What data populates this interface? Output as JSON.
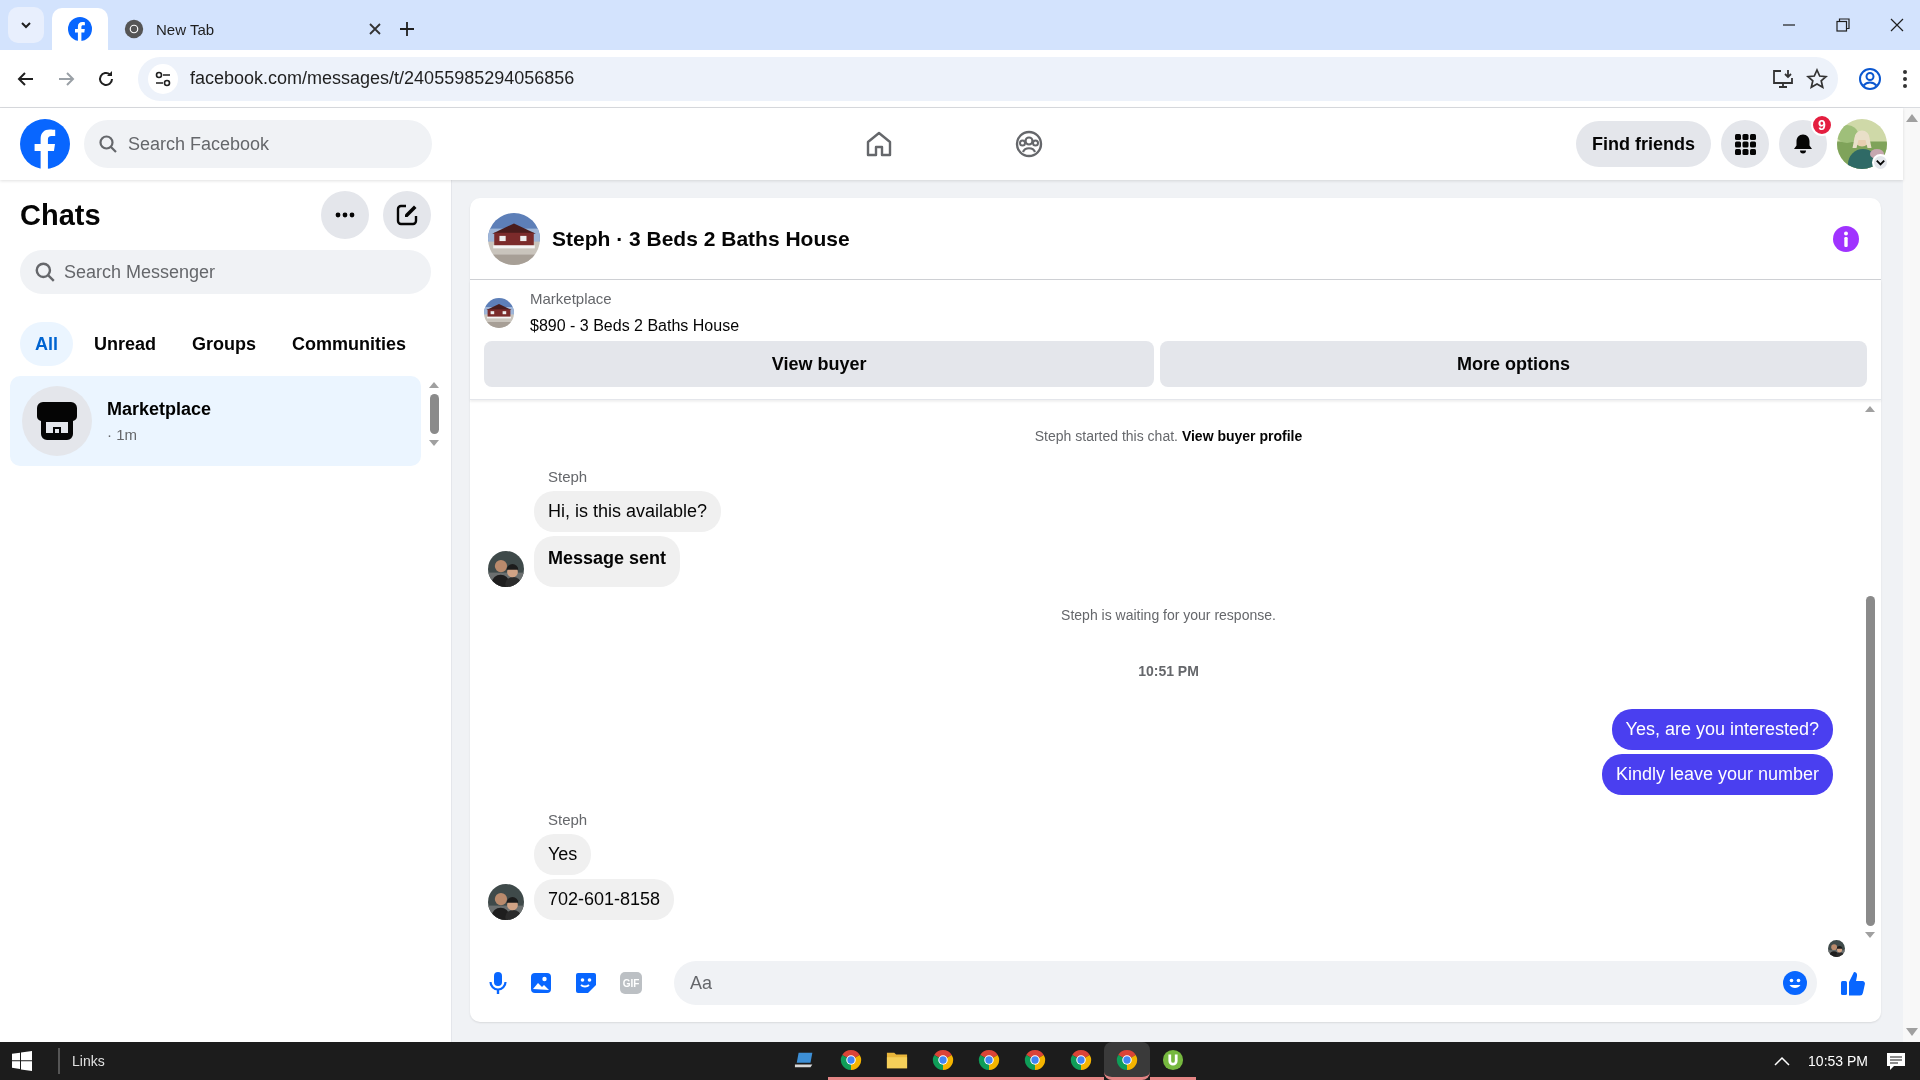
{
  "browser": {
    "tabs": [
      {
        "kind": "facebook",
        "selected": true
      },
      {
        "kind": "chrome",
        "title": "New Tab",
        "selected": false
      }
    ],
    "url": "facebook.com/messages/t/24055985294056856"
  },
  "facebook_header": {
    "search": {
      "placeholder": "Search Facebook"
    },
    "find_friends": "Find friends",
    "notifications_badge": "9"
  },
  "chats": {
    "title": "Chats",
    "search": {
      "placeholder": "Search Messenger"
    },
    "filters": [
      {
        "label": "All",
        "selected": true
      },
      {
        "label": "Unread",
        "selected": false
      },
      {
        "label": "Groups",
        "selected": false
      },
      {
        "label": "Communities",
        "selected": false
      }
    ],
    "conversations": [
      {
        "name": "Marketplace",
        "time": "· 1m",
        "selected": true
      }
    ]
  },
  "conversation": {
    "title": "Steph · 3 Beds 2 Baths House",
    "listing": {
      "source": "Marketplace",
      "title": "$890 - 3 Beds 2 Baths House"
    },
    "actions": [
      "View buyer",
      "More options"
    ],
    "messages": [
      {
        "kind": "system",
        "text": "Steph started this chat.",
        "link": "View buyer profile"
      },
      {
        "kind": "incoming",
        "sender": "Steph",
        "bubbles": [
          {
            "text": "Hi, is this available?",
            "bold": false
          },
          {
            "text": "Message sent",
            "bold": true
          }
        ]
      },
      {
        "kind": "system",
        "text": "Steph is waiting for your response."
      },
      {
        "kind": "timestamp",
        "text": "10:51 PM"
      },
      {
        "kind": "outgoing",
        "bubbles": [
          {
            "text": "Yes, are you interested?",
            "bold": false
          },
          {
            "text": "Kindly leave your number",
            "bold": false
          }
        ]
      },
      {
        "kind": "incoming",
        "sender": "Steph",
        "bubbles": [
          {
            "text": "Yes",
            "bold": false
          },
          {
            "text": "702-601-8158",
            "bold": false
          }
        ]
      },
      {
        "kind": "seen"
      }
    ],
    "composer": {
      "placeholder": "Aa",
      "gif": "GIF"
    }
  },
  "taskbar": {
    "toolbar": "Links",
    "clock": "10:53 PM"
  }
}
